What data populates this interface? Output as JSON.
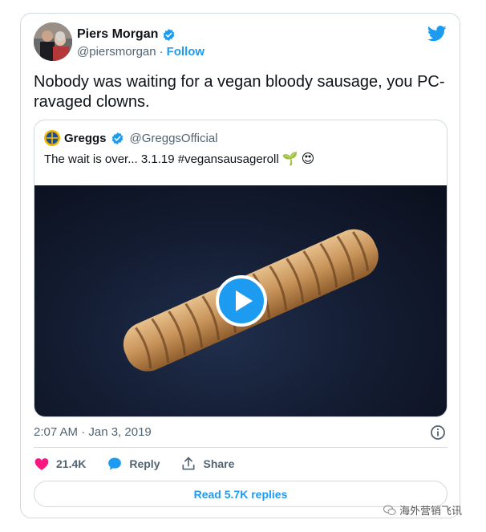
{
  "author": {
    "name": "Piers Morgan",
    "handle": "@piersmorgan",
    "follow_label": "Follow"
  },
  "tweet": {
    "text": "Nobody was waiting for a vegan bloody sausage, you PC-ravaged clowns.",
    "timestamp": "2:07 AM · Jan 3, 2019"
  },
  "quoted_tweet": {
    "name": "Greggs",
    "handle": "@GreggsOfficial",
    "text": "The wait is over... 3.1.19 #vegansausageroll",
    "emoji": [
      "🌱",
      "😍"
    ]
  },
  "actions": {
    "like_count": "21.4K",
    "reply_label": "Reply",
    "share_label": "Share"
  },
  "read_replies_label": "Read 5.7K replies",
  "watermark": "海外营销飞讯",
  "colors": {
    "accent": "#1d9bf0",
    "like": "#f91880",
    "text": "#0f1419",
    "muted": "#536471",
    "border": "#cfd9de"
  },
  "icons": [
    "verified-badge-icon",
    "twitter-bird-icon",
    "play-icon",
    "info-icon",
    "heart-icon",
    "reply-bubble-icon",
    "share-icon",
    "wechat-icon"
  ]
}
